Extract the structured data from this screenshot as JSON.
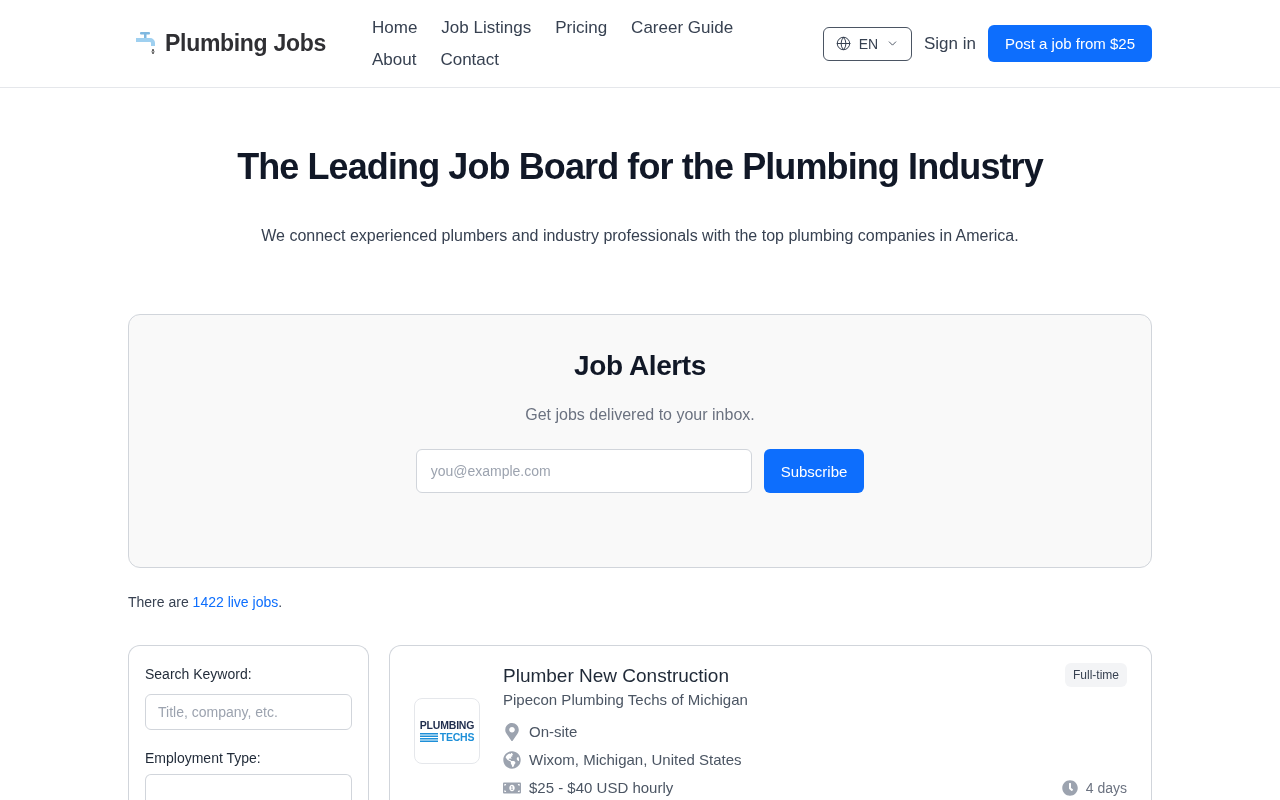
{
  "header": {
    "logo": "Plumbing Jobs",
    "nav": [
      {
        "label": "Home"
      },
      {
        "label": "Job Listings"
      },
      {
        "label": "Pricing"
      },
      {
        "label": "Career Guide"
      },
      {
        "label": "About"
      },
      {
        "label": "Contact"
      }
    ],
    "language": "EN",
    "sign_in": "Sign in",
    "post_button": "Post a job from $25"
  },
  "hero": {
    "title": "The Leading Job Board for the Plumbing Industry",
    "subtitle": "We connect experienced plumbers and industry professionals with the top plumbing companies in America."
  },
  "job_alerts": {
    "title": "Job Alerts",
    "subtitle": "Get jobs delivered to your inbox.",
    "email": {
      "placeholder": "you@example.com"
    },
    "button": "Subscribe"
  },
  "live_jobs": {
    "prefix": "There are ",
    "link": "1422 live jobs",
    "suffix": "."
  },
  "filters": [
    {
      "kind": "text",
      "label": "Search Keyword:",
      "placeholder": "Title, company, etc."
    },
    {
      "kind": "select",
      "label": "Employment Type:"
    }
  ],
  "jobs": [
    {
      "title": "Plumber New Construction",
      "company": "Pipecon Plumbing Techs of Michigan",
      "logo": [
        "PLUMBING",
        "TECHS"
      ],
      "type": "Full-time",
      "details": [
        {
          "kind": "workplace",
          "text": "On-site"
        },
        {
          "kind": "location",
          "text": "Wixom, Michigan, United States"
        },
        {
          "kind": "salary",
          "text": "$25 - $40 USD hourly"
        }
      ],
      "posted": "4 days"
    }
  ]
}
